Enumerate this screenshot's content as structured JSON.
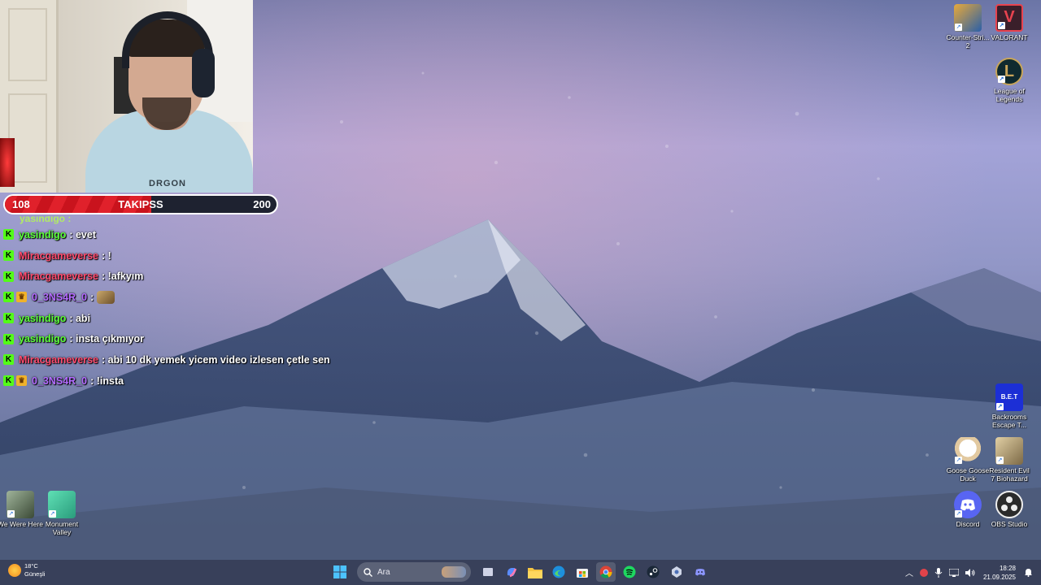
{
  "goal": {
    "start": "108",
    "title": "TAKIPSS",
    "end": "200",
    "progress": 0.54
  },
  "chat": {
    "cut_text": "yasindigo :",
    "lines": [
      {
        "user": "yasindigo",
        "user_color": "#5cff3a",
        "message": ": evet",
        "crown": false,
        "emote": false
      },
      {
        "user": "Miracgameverse",
        "user_color": "#ff4b6e",
        "message": ": !",
        "crown": false,
        "emote": false
      },
      {
        "user": "Miracgameverse",
        "user_color": "#ff4b6e",
        "message": ": !afkyım",
        "crown": false,
        "emote": false
      },
      {
        "user": "0_3NS4R_0",
        "user_color": "#b36bff",
        "message": ":",
        "crown": true,
        "emote": true
      },
      {
        "user": "yasindigo",
        "user_color": "#5cff3a",
        "message": ": abi",
        "crown": false,
        "emote": false
      },
      {
        "user": "yasindigo",
        "user_color": "#5cff3a",
        "message": ": insta çıkmıyor",
        "crown": false,
        "emote": false
      },
      {
        "user": "Miracgameverse",
        "user_color": "#ff4b6e",
        "message": ": abi 10 dk yemek yicem video izlesen çetle sen",
        "crown": false,
        "emote": false
      },
      {
        "user": "0_3NS4R_0",
        "user_color": "#b36bff",
        "message": ": !insta",
        "crown": true,
        "emote": false
      }
    ]
  },
  "webcam": {
    "shirt_text": "DRGON"
  },
  "desktop_icons": {
    "cs2": {
      "label": "Counter-Stri... 2",
      "icon": "counter-strike-icon",
      "color": "#2a5fa8"
    },
    "valorant": {
      "label": "VALORANT",
      "icon": "valorant-icon",
      "color": "#e8434f"
    },
    "lol": {
      "label": "League of Legends",
      "icon": "league-of-legends-icon",
      "color": "#c8a55a"
    },
    "backrooms": {
      "label": "Backrooms Escape T...",
      "badge": "B.E.T",
      "icon": "backrooms-icon",
      "color": "#1c2fd6"
    },
    "goose": {
      "label": "Goose Goose Duck",
      "icon": "goose-goose-duck-icon",
      "color": "#f3efe6"
    },
    "re7": {
      "label": "Resident Evil 7 Biohazard",
      "icon": "resident-evil-icon",
      "color": "#c9b48a"
    },
    "discord": {
      "label": "Discord",
      "icon": "discord-icon",
      "color": "#5865f2"
    },
    "obs": {
      "label": "OBS Studio",
      "icon": "obs-studio-icon",
      "color": "#2b2b2b"
    },
    "wewerehere": {
      "label": "We Were Here",
      "icon": "we-were-here-icon",
      "color": "#5a6e4f"
    },
    "monument": {
      "label": "Monument Valley",
      "icon": "monument-valley-icon",
      "color": "#3fbf9a"
    }
  },
  "taskbar": {
    "weather_temp": "18°C",
    "weather_desc": "Güneşli",
    "search_placeholder": "Ara",
    "time": "18:28",
    "date": "21.09.2025",
    "apps": [
      "start-icon",
      "search-icon",
      "task-view-icon",
      "copilot-icon",
      "file-explorer-icon",
      "edge-icon",
      "store-icon",
      "chrome-icon",
      "spotify-icon",
      "steam-icon",
      "vpn-icon",
      "discord-icon"
    ]
  }
}
